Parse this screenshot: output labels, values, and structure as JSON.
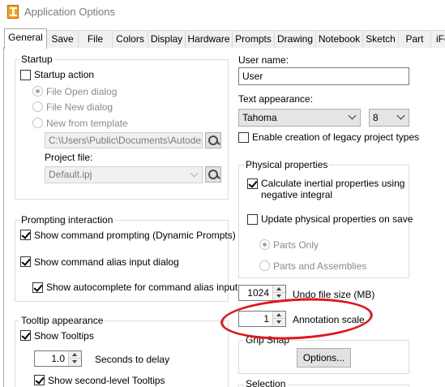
{
  "window": {
    "title": "Application Options"
  },
  "tabs": [
    "General",
    "Save",
    "File",
    "Colors",
    "Display",
    "Hardware",
    "Prompts",
    "Drawing",
    "Notebook",
    "Sketch",
    "Part",
    "iFe"
  ],
  "startup": {
    "legend": "Startup",
    "startup_action": "Startup action",
    "file_open": "File Open dialog",
    "file_new": "File New dialog",
    "new_template": "New from template",
    "template_path": "C:\\Users\\Public\\Documents\\Autodesk\\I",
    "project_file_label": "Project file:",
    "project_file_value": "Default.ipj"
  },
  "prompting": {
    "legend": "Prompting interaction",
    "show_prompting": "Show command prompting (Dynamic Prompts)",
    "show_alias": "Show command alias input dialog",
    "show_autocomplete": "Show autocomplete for command alias input"
  },
  "tooltip": {
    "legend": "Tooltip appearance",
    "show_tooltips": "Show Tooltips",
    "delay_value": "1.0",
    "delay_label": "Seconds to delay",
    "second_level": "Show second-level Tooltips"
  },
  "user": {
    "name_label": "User name:",
    "name_value": "User",
    "appearance_label": "Text appearance:",
    "font_value": "Tahoma",
    "size_value": "8",
    "legacy_label": "Enable creation of legacy project types"
  },
  "physical": {
    "legend": "Physical properties",
    "calc_inertial": "Calculate inertial properties using",
    "calc_inertial_2": "negative integral",
    "update_on_save": "Update physical properties on save",
    "parts_only": "Parts Only",
    "parts_assemblies": "Parts and Assemblies"
  },
  "undo": {
    "value": "1024",
    "label": "Undo file size (MB)"
  },
  "annotation": {
    "value": "1",
    "label": "Annotation scale"
  },
  "grip": {
    "legend": "Grip Snap",
    "options_label": "Options..."
  },
  "selection": {
    "legend": "Selection"
  },
  "colors": {
    "highlight": "#e0151b"
  }
}
